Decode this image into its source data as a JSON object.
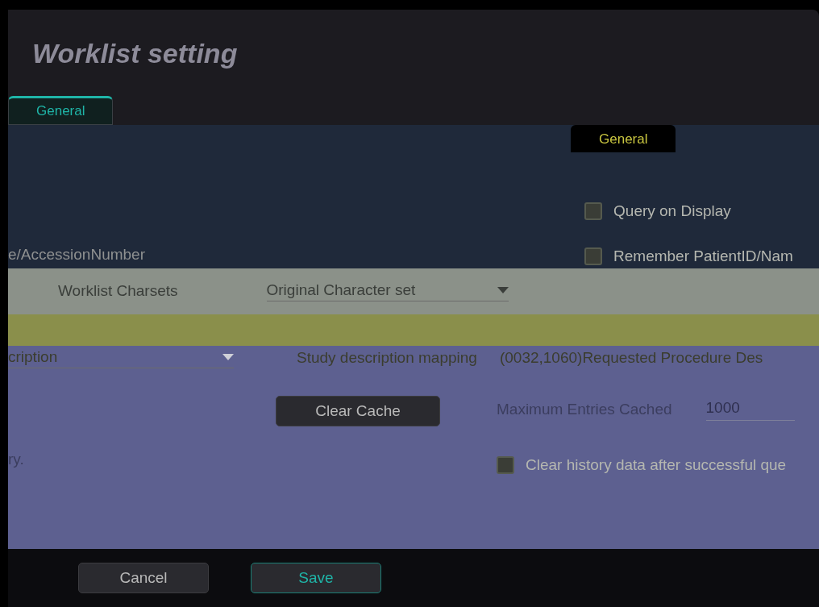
{
  "dialog": {
    "title": "Worklist setting"
  },
  "tabs": [
    {
      "label": "General",
      "selected": true
    },
    {
      "label": "General",
      "selected": false
    }
  ],
  "query_options": [
    {
      "label": "Query on Display",
      "checked": false
    },
    {
      "label": "Remember PatientID/Nam",
      "checked": false
    }
  ],
  "fragment_top": "e/AccessionNumber",
  "charsets": {
    "label": "Worklist Charsets",
    "value": "Original Character set"
  },
  "description": {
    "value": "cription",
    "label": "Study description mapping",
    "mapping": "(0032,1060)Requested Procedure Des"
  },
  "cache": {
    "button": "Clear Cache",
    "label": "Maximum Entries Cached",
    "value": "1000"
  },
  "fragment_bottom": "ry.",
  "history_option": {
    "label": "Clear history data after successful que",
    "checked": false
  },
  "buttons": [
    {
      "label": "Cancel",
      "kind": "secondary"
    },
    {
      "label": "Save",
      "kind": "primary"
    }
  ]
}
